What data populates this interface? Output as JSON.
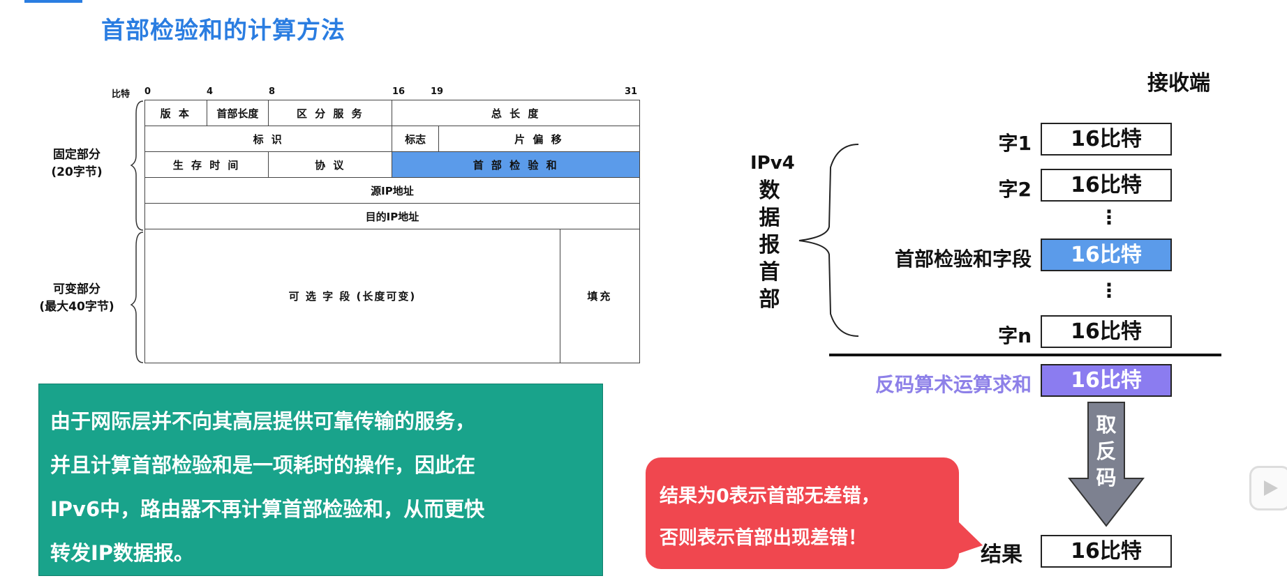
{
  "title": "首部检验和的计算方法",
  "bits_label": "比特",
  "bit_ticks": [
    "0",
    "4",
    "8",
    "16",
    "19",
    "31"
  ],
  "header_rows": {
    "r1": [
      "版 本",
      "首部长度",
      "区 分 服 务",
      "总 长 度"
    ],
    "r2": [
      "标 识",
      "标志",
      "片 偏 移"
    ],
    "r3": [
      "生 存 时 间",
      "协 议",
      "首 部 检 验 和"
    ],
    "r4": "源IP地址",
    "r5": "目的IP地址",
    "r6": [
      "可 选 字 段 (长度可变)",
      "填充"
    ]
  },
  "fixed_part": [
    "固定部分",
    "(20字节)"
  ],
  "variable_part": [
    "可变部分",
    "(最大40字节)"
  ],
  "note_lines": [
    "由于网际层并不向其高层提供可靠传输的服务，",
    "并且计算首部检验和是一项耗时的操作，因此在",
    "IPv6中，路由器不再计算首部检验和，从而更快",
    "转发IP数据报。"
  ],
  "receiver_title": "接收端",
  "ipv4_label": [
    "IPv4",
    "数",
    "据",
    "报",
    "首",
    "部"
  ],
  "words": [
    {
      "label": "字1",
      "value": "16比特"
    },
    {
      "label": "字2",
      "value": "16比特"
    },
    {
      "label": "首部检验和字段",
      "value": "16比特"
    },
    {
      "label": "字n",
      "value": "16比特"
    }
  ],
  "ellipsis": "⋮",
  "sum_label": "反码算术运算求和",
  "sum_value": "16比特",
  "arrow_text": "取反码",
  "result_label": "结果",
  "result_value": "16比特",
  "bubble_lines": [
    "结果为0表示首部无差错，",
    "否则表示首部出现差错！"
  ],
  "colors": {
    "blue": "#2a7de1",
    "checksum": "#5b9bea",
    "purple": "#8b7cf0",
    "green": "#19a38b",
    "red": "#f0474f"
  }
}
